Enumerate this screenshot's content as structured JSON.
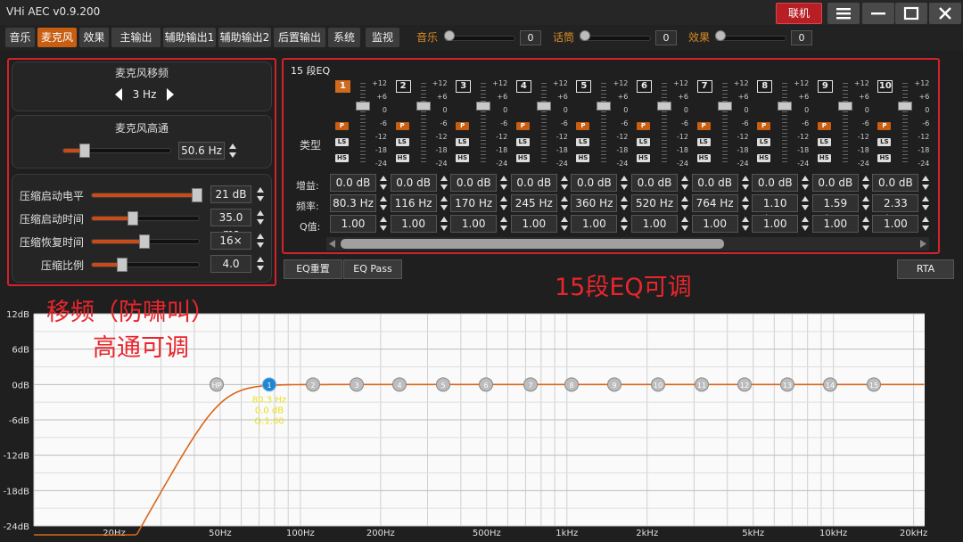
{
  "app": {
    "title": "VHi AEC v0.9.200",
    "connect_label": "联机"
  },
  "tabs": [
    {
      "label": "音乐"
    },
    {
      "label": "麦克风",
      "active": true
    },
    {
      "label": "效果"
    },
    {
      "label": "主输出"
    },
    {
      "label": "辅助输出1"
    },
    {
      "label": "辅助输出2"
    },
    {
      "label": "后置输出"
    },
    {
      "label": "系统"
    },
    {
      "label": "监视"
    }
  ],
  "volumes": [
    {
      "label": "音乐",
      "value": "0"
    },
    {
      "label": "话筒",
      "value": "0"
    },
    {
      "label": "效果",
      "value": "0"
    }
  ],
  "mic": {
    "shift": {
      "title": "麦克风移频",
      "value": "3 Hz"
    },
    "highpass": {
      "title": "麦克风高通",
      "value": "50.6 Hz",
      "level": 0.2
    },
    "comp": [
      {
        "label": "压缩启动电平",
        "value": "21 dB",
        "level": 0.97
      },
      {
        "label": "压缩启动时间",
        "value": "35.0 ms",
        "level": 0.38
      },
      {
        "label": "压缩恢复时间",
        "value": "16×",
        "level": 0.48
      },
      {
        "label": "压缩比例",
        "value": "4.0",
        "level": 0.28
      }
    ]
  },
  "eq": {
    "title": "15 段EQ",
    "scale": [
      "+12",
      "+6",
      "0",
      "-6",
      "-12",
      "-18",
      "-24"
    ],
    "type_label": "类型",
    "types": {
      "p": "P",
      "ls": "LS",
      "hs": "HS"
    },
    "row_labels": {
      "gain": "增益:",
      "freq": "频率:",
      "q": "Q值:"
    },
    "bands": [
      {
        "num": "1",
        "gain": "0.0 dB",
        "freq": "80.3 Hz",
        "q": "1.00"
      },
      {
        "num": "2",
        "gain": "0.0 dB",
        "freq": "116 Hz",
        "q": "1.00"
      },
      {
        "num": "3",
        "gain": "0.0 dB",
        "freq": "170 Hz",
        "q": "1.00"
      },
      {
        "num": "4",
        "gain": "0.0 dB",
        "freq": "245 Hz",
        "q": "1.00"
      },
      {
        "num": "5",
        "gain": "0.0 dB",
        "freq": "360 Hz",
        "q": "1.00"
      },
      {
        "num": "6",
        "gain": "0.0 dB",
        "freq": "520 Hz",
        "q": "1.00"
      },
      {
        "num": "7",
        "gain": "0.0 dB",
        "freq": "764 Hz",
        "q": "1.00"
      },
      {
        "num": "8",
        "gain": "0.0 dB",
        "freq": "1.10 kHz",
        "q": "1.00"
      },
      {
        "num": "9",
        "gain": "0.0 dB",
        "freq": "1.59 kHz",
        "q": "1.00"
      },
      {
        "num": "10",
        "gain": "0.0 dB",
        "freq": "2.33 kHz",
        "q": "1.00"
      }
    ],
    "reset_label": "EQ重置",
    "pass_label": "EQ Pass",
    "rta_label": "RTA"
  },
  "annotations": {
    "left_line1": "移频（防啸叫）",
    "left_line2": "高通可调",
    "eq": "15段EQ可调"
  },
  "graph": {
    "y_ticks": [
      "12dB",
      "6dB",
      "0dB",
      "-6dB",
      "-12dB",
      "-18dB",
      "-24dB"
    ],
    "x_ticks": [
      "20Hz",
      "50Hz",
      "100Hz",
      "200Hz",
      "500Hz",
      "1kHz",
      "2kHz",
      "5kHz",
      "10kHz",
      "20kHz"
    ],
    "nodes": [
      "HP",
      "1",
      "2",
      "3",
      "4",
      "5",
      "6",
      "7",
      "8",
      "9",
      "10",
      "11",
      "12",
      "13",
      "14",
      "15"
    ],
    "tooltip": [
      "80.3 Hz",
      "0.0 dB",
      "Q:1.00"
    ],
    "colors": {
      "curve": "#d9651a",
      "selected_node": "#1f86cf",
      "node": "#bdbdbd",
      "tooltip": "#e8e020",
      "annotation": "#e8262c"
    }
  }
}
